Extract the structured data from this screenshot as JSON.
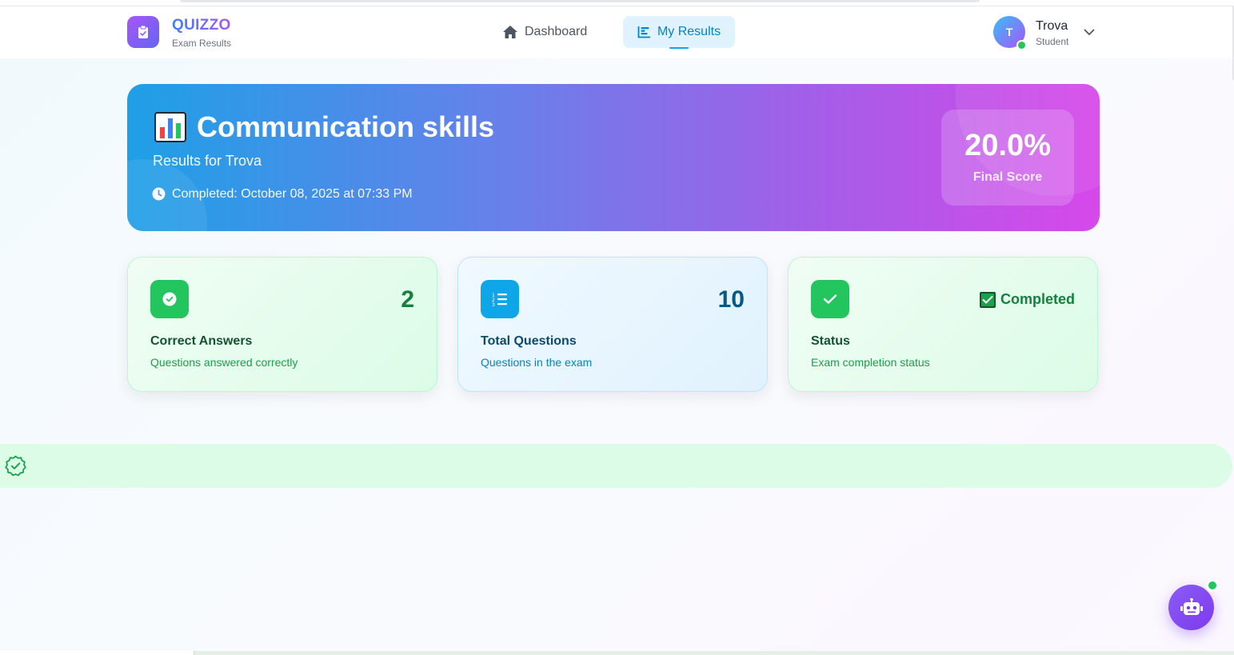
{
  "brand": {
    "title": "QUIZZO",
    "subtitle": "Exam Results",
    "icon": "clipboard-icon"
  },
  "nav": {
    "dashboard_label": "Dashboard",
    "results_label": "My Results",
    "active": "My Results"
  },
  "user": {
    "initial": "T",
    "name": "Trova",
    "role": "Student",
    "online": true
  },
  "hero": {
    "icon": "bar-chart-emoji",
    "title": "Communication skills",
    "subtitle": "Results for Trova",
    "completed_text": "Completed: October 08, 2025 at 07:33 PM",
    "score_value": "20.0%",
    "score_label": "Final Score"
  },
  "cards": [
    {
      "value": "2",
      "title": "Correct Answers",
      "description": "Questions answered correctly",
      "icon": "check-circle-icon"
    },
    {
      "value": "10",
      "title": "Total Questions",
      "description": "Questions in the exam",
      "icon": "list-ol-icon"
    },
    {
      "value": "Completed",
      "title": "Status",
      "description": "Exam completion status",
      "icon": "check-icon"
    }
  ],
  "colors": {
    "accent_blue": "#0ea5e9",
    "accent_purple": "#a855f7",
    "success_green": "#22c55e",
    "hero_start": "#1ea0e6",
    "hero_end": "#d648ea"
  }
}
